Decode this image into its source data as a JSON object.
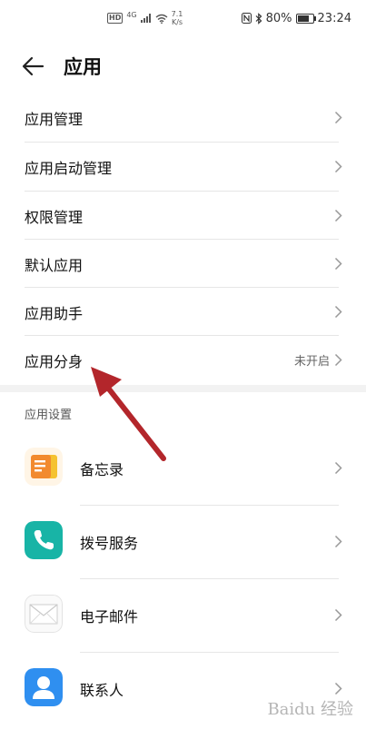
{
  "status_bar": {
    "hd": "HD",
    "network": "4G",
    "speed_value": "7.1",
    "speed_unit": "K/s",
    "battery_percent": "80%",
    "battery_level": 0.8,
    "time": "23:24",
    "icons": [
      "hd-icon",
      "signal-icon",
      "wifi-icon",
      "nfc-icon",
      "bluetooth-icon",
      "battery-icon"
    ]
  },
  "header": {
    "title": "应用",
    "back_icon": "back-arrow-icon"
  },
  "menu": [
    {
      "label": "应用管理",
      "value": ""
    },
    {
      "label": "应用启动管理",
      "value": ""
    },
    {
      "label": "权限管理",
      "value": ""
    },
    {
      "label": "默认应用",
      "value": ""
    },
    {
      "label": "应用助手",
      "value": ""
    },
    {
      "label": "应用分身",
      "value": "未开启"
    }
  ],
  "section": {
    "title": "应用设置"
  },
  "apps": [
    {
      "label": "备忘录",
      "icon": "notepad-icon"
    },
    {
      "label": "拨号服务",
      "icon": "phone-icon"
    },
    {
      "label": "电子邮件",
      "icon": "mail-icon"
    },
    {
      "label": "联系人",
      "icon": "contacts-icon"
    }
  ],
  "watermark": "Baidu 经验",
  "colors": {
    "annotation_arrow": "#b3262b",
    "notepad_orange": "#f28a2e",
    "phone_teal": "#18b4a6",
    "contacts_blue": "#2f8ff0"
  }
}
